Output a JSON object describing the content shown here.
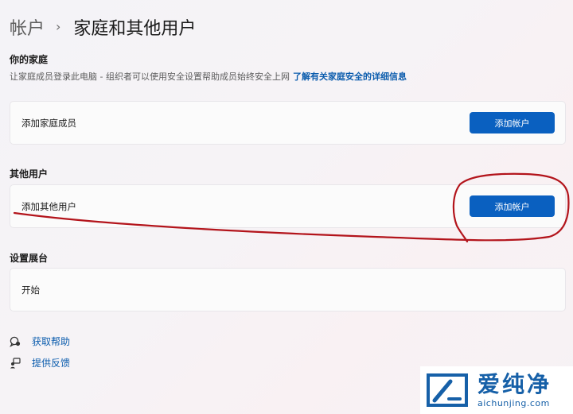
{
  "breadcrumb": {
    "parent": "帐户",
    "separator": "›",
    "current": "家庭和其他用户"
  },
  "family": {
    "heading": "你的家庭",
    "description": "让家庭成员登录此电脑 - 组织者可以使用安全设置帮助成员始终安全上网",
    "link": "了解有关家庭安全的详细信息",
    "row_label": "添加家庭成员",
    "button_label": "添加帐户"
  },
  "other_users": {
    "heading": "其他用户",
    "row_label": "添加其他用户",
    "button_label": "添加帐户"
  },
  "kiosk": {
    "heading": "设置展台",
    "row_label": "开始"
  },
  "help": {
    "get_help": "获取帮助",
    "feedback": "提供反馈"
  },
  "watermark": {
    "title": "爱纯净",
    "url": "aichunjing.com"
  },
  "colors": {
    "accent": "#0a60c0",
    "link": "#0b5cad",
    "annotation": "#b3141b"
  }
}
